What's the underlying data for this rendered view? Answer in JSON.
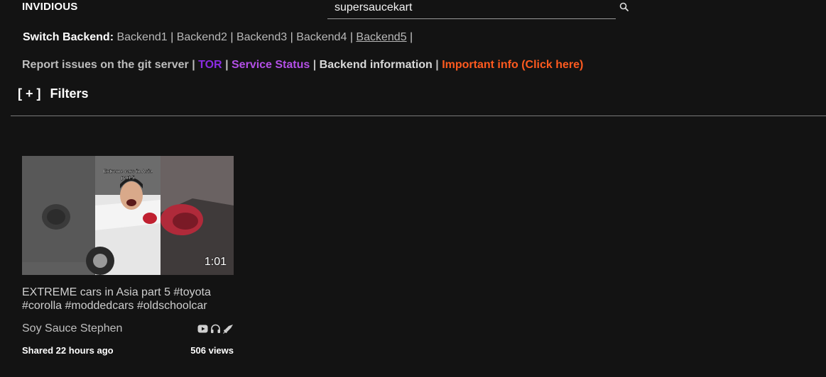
{
  "header": {
    "brand": "INVIDIOUS",
    "search_value": "supersaucekart"
  },
  "backends": {
    "label": "Switch Backend:",
    "items": [
      "Backend1",
      "Backend2",
      "Backend3",
      "Backend4",
      "Backend5"
    ],
    "separator": "|"
  },
  "links": {
    "report": "Report issues on the git server",
    "tor": "TOR",
    "status": "Service Status",
    "backend_info": "Backend information",
    "important": "Important info (Click here)",
    "separator": "|"
  },
  "filters": {
    "toggle": "[ + ]",
    "label": "Filters"
  },
  "video": {
    "thumb_caption_line1": "Extreme cars in Asia",
    "thumb_caption_line2": "part 5",
    "duration": "1:01",
    "title": "EXTREME cars in Asia part 5 #toyota #corolla #moddedcars #oldschoolcar",
    "channel": "Soy Sauce Stephen",
    "shared": "Shared 22 hours ago",
    "views": "506 views"
  }
}
